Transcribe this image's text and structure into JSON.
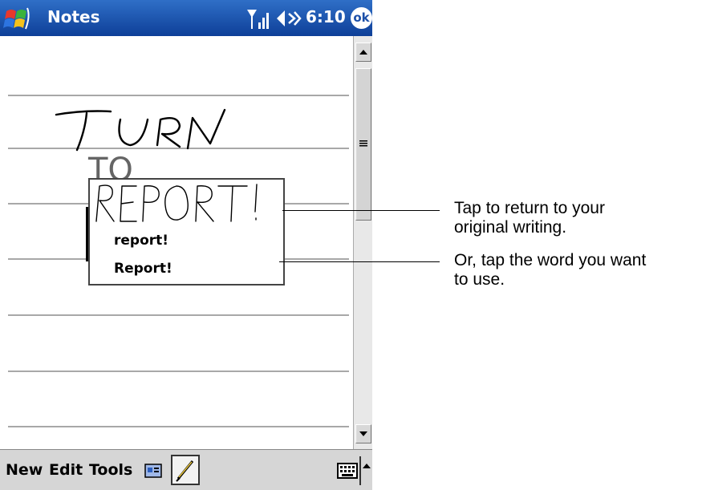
{
  "titlebar": {
    "title": "Notes",
    "clock": "6:10",
    "ok_label": "ok"
  },
  "menubar": {
    "items": [
      "New",
      "Edit",
      "Tools"
    ]
  },
  "ink": {
    "line1": "TURN",
    "line2": "TO",
    "popup_ink": "REPORT!"
  },
  "popup": {
    "options": [
      "report!",
      "Report!"
    ]
  },
  "annotations": [
    {
      "line1": "Tap to return to your",
      "line2": "original writing."
    },
    {
      "line1": "Or, tap the word you want",
      "line2": "to use."
    }
  ],
  "colors": {
    "titlebar": "#1a4fa8",
    "menubar": "#d6d6d6",
    "ruled_lines": "#a8a8a8"
  },
  "icons": [
    "windows-start-icon",
    "signal-icon",
    "volume-icon",
    "ok-icon",
    "card-icon",
    "pen-icon",
    "keyboard-icon",
    "up-arrow-icon",
    "scroll-up-icon",
    "scroll-down-icon"
  ]
}
